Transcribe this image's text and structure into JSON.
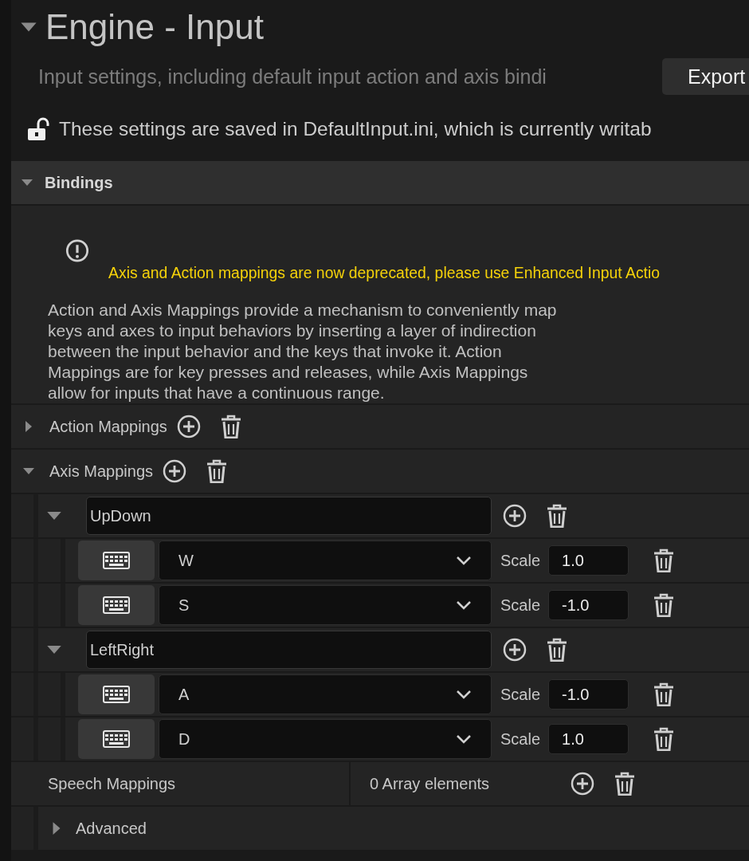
{
  "header": {
    "title": "Engine - Input",
    "expanded": true,
    "description": "Input settings, including default input action and axis bindi",
    "export_button": "Export",
    "notice": "These settings are saved in DefaultInput.ini, which is currently writab",
    "locked": false
  },
  "category": {
    "title": "Bindings",
    "expanded": true
  },
  "warning": "Axis and Action mappings are now deprecated, please use Enhanced Input Actio",
  "help": "Action and Axis Mappings provide a mechanism to conveniently map keys and axes to input behaviors by inserting a layer of indirection between the input behavior and the keys that invoke it. Action Mappings are for key presses and releases, while Axis Mappings allow for inputs that have a continuous range.",
  "arrays": [
    {
      "label": "Action Mappings",
      "expanded": false
    },
    {
      "label": "Axis Mappings",
      "expanded": true,
      "children": [
        {
          "name": "UpDown",
          "expanded": true,
          "children": [
            {
              "key": "W",
              "scale_label": "Scale",
              "scale": "1.0"
            },
            {
              "key": "S",
              "scale_label": "Scale",
              "scale": "-1.0"
            }
          ]
        },
        {
          "name": "LeftRight",
          "expanded": true,
          "children": [
            {
              "key": "A",
              "scale_label": "Scale",
              "scale": "-1.0"
            },
            {
              "key": "D",
              "scale_label": "Scale",
              "scale": "1.0"
            }
          ]
        }
      ]
    }
  ],
  "speech": {
    "label": "Speech Mappings",
    "count": "0 Array elements"
  },
  "advanced": {
    "label": "Advanced",
    "expanded": false
  }
}
